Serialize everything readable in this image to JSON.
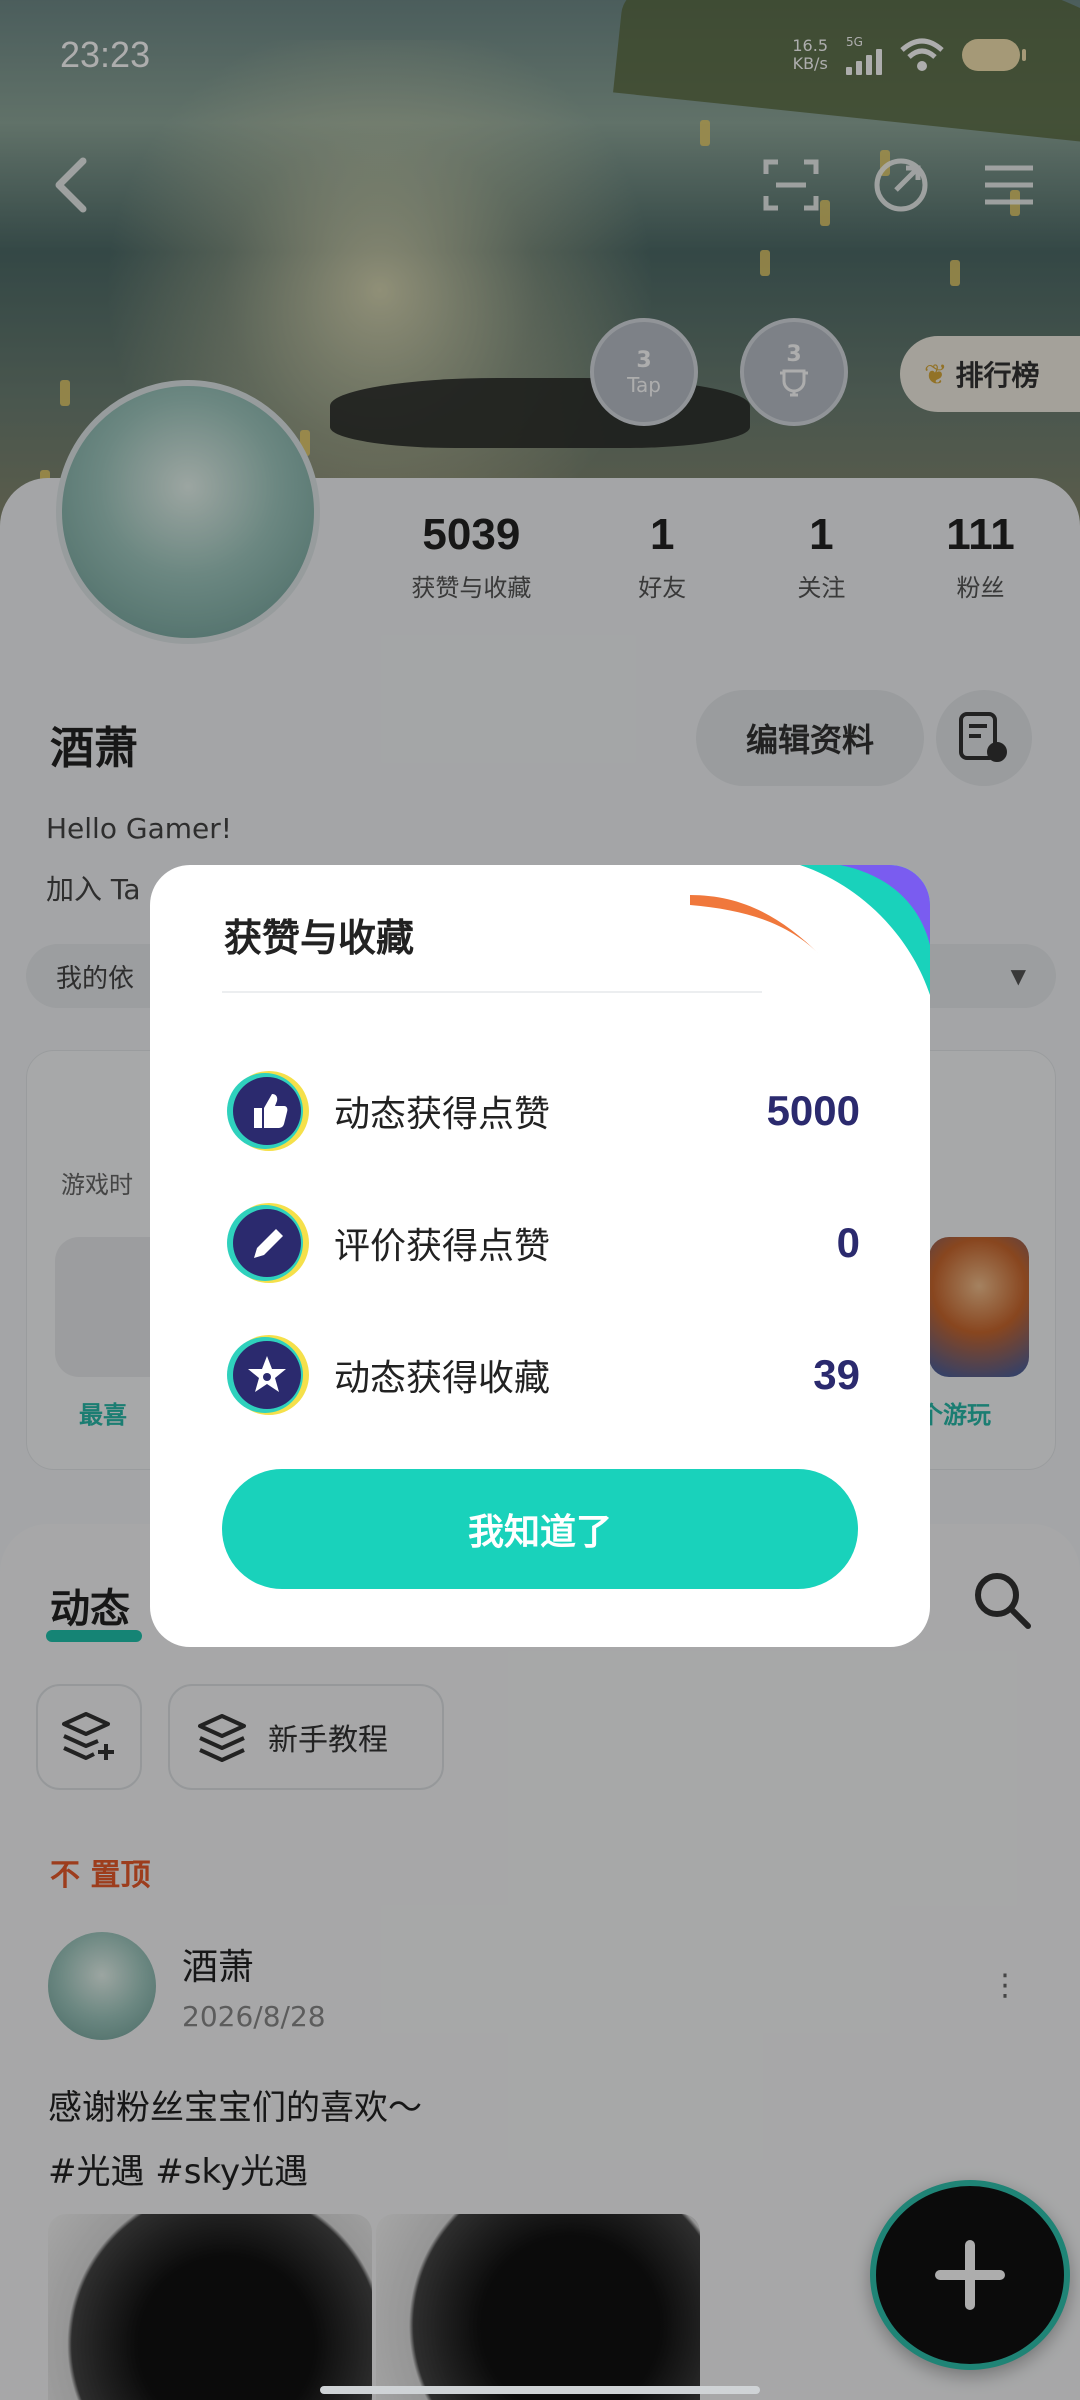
{
  "status_bar": {
    "time": "23:23",
    "speed_value": "16.5",
    "speed_unit": "KB/s",
    "network": "5G"
  },
  "header": {
    "badges": [
      {
        "num": "3",
        "text": "Tap"
      },
      {
        "num": "3",
        "text": ""
      }
    ],
    "ranking_label": "排行榜"
  },
  "profile": {
    "stats": [
      {
        "value": "5039",
        "label": "获赞与收藏"
      },
      {
        "value": "1",
        "label": "好友"
      },
      {
        "value": "1",
        "label": "关注"
      },
      {
        "value": "111",
        "label": "粉丝"
      }
    ],
    "username": "酒萧",
    "edit_label": "编辑资料",
    "bio_line1": "Hello Gamer!",
    "bio_line2": "加入 Ta",
    "pill_text": "我的依"
  },
  "game_card": {
    "label": "游戏时",
    "favorite_label": "最喜",
    "count_label": "个游玩"
  },
  "feed": {
    "tab_label": "动态",
    "tutorial_label": "新手教程",
    "pin_label": "不 置顶",
    "post": {
      "author": "酒萧",
      "date": "2026/8/28",
      "text_line1": "感谢粉丝宝宝们的喜欢～",
      "text_line2": "#光遇 #sky光遇"
    }
  },
  "modal": {
    "title": "获赞与收藏",
    "rows": [
      {
        "label": "动态获得点赞",
        "value": "5000",
        "icon": "thumbs-up-icon"
      },
      {
        "label": "评价获得点赞",
        "value": "0",
        "icon": "pencil-icon"
      },
      {
        "label": "动态获得收藏",
        "value": "39",
        "icon": "star-icon"
      }
    ],
    "confirm_label": "我知道了"
  },
  "colors": {
    "accent": "#19d2bb",
    "value_text": "#2b2a6e",
    "icon_bg": "#2b2a6e",
    "icon_ring": "#f5e04a",
    "pin": "#e75a2c"
  }
}
